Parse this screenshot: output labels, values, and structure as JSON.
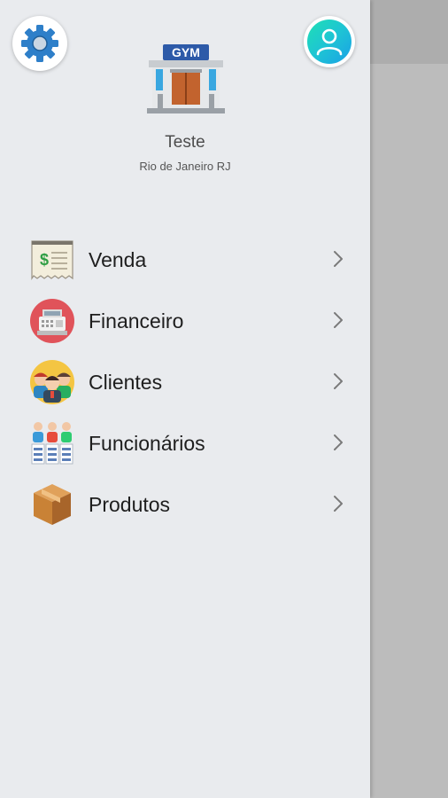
{
  "header": {
    "settings_icon": "gear-icon",
    "profile_icon": "user-icon",
    "logo_text": "GYM",
    "company_name": "Teste",
    "company_location": "Rio de Janeiro RJ"
  },
  "menu": {
    "items": [
      {
        "label": "Venda",
        "icon": "receipt-icon"
      },
      {
        "label": "Financeiro",
        "icon": "cash-register-icon"
      },
      {
        "label": "Clientes",
        "icon": "people-icon"
      },
      {
        "label": "Funcionários",
        "icon": "employees-icon"
      },
      {
        "label": "Produtos",
        "icon": "box-icon"
      }
    ]
  },
  "colors": {
    "drawer_bg": "#e9ebee",
    "accent_gradient_start": "#1fe0b4",
    "accent_gradient_end": "#1ba1e6",
    "gear": "#2e7fc9",
    "chevron": "#7a7a7a"
  }
}
